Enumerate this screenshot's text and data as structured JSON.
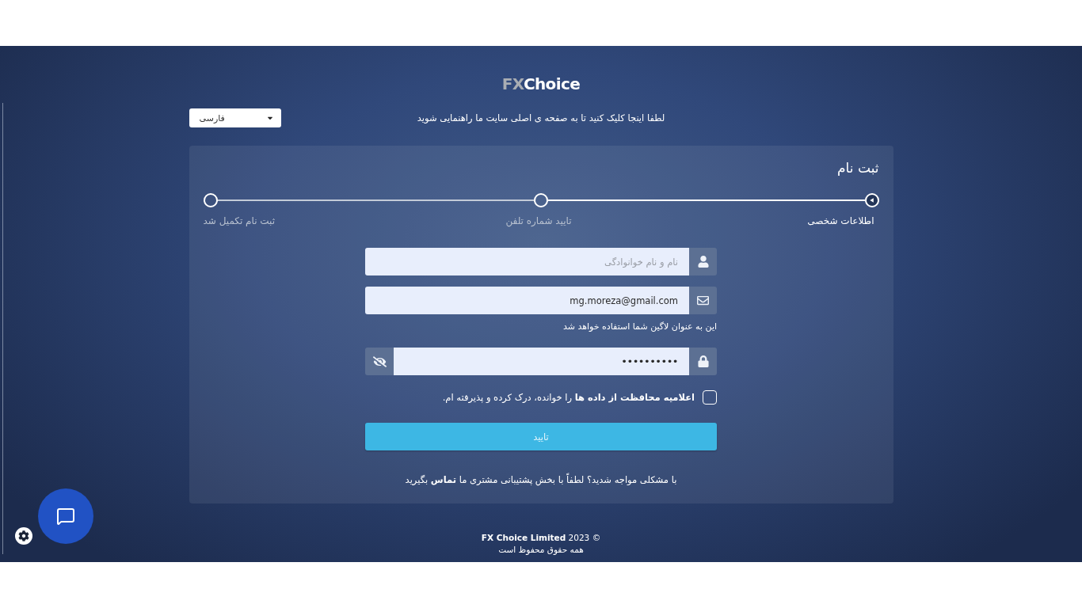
{
  "logo": {
    "prefix": "FX",
    "name": "Choice"
  },
  "header": {
    "language": "فارسی",
    "home_link": "لطفا اینجا کلیک کنید تا به صفحه ی اصلی سایت ما راهنمایی شوید"
  },
  "registration": {
    "title": "ثبت نام",
    "steps": [
      {
        "label": "اطلاعات شخصی",
        "selected": true
      },
      {
        "label": "تایید شماره تلفن",
        "selected": false
      },
      {
        "label": "ثبت نام تکمیل شد",
        "selected": false
      }
    ],
    "fields": [
      {
        "kind": "name",
        "placeholder": "نام و نام خوانوادگی"
      },
      {
        "kind": "email",
        "value": "mg.moreza@gmail.com",
        "hint": "این به عنوان لاگین شما استفاده خواهد شد"
      },
      {
        "kind": "password",
        "value": "••••••••••"
      }
    ],
    "consent": {
      "checked": false,
      "text": "**اعلامیه محافظت از داده ها** را خوانده، درک کرده و پذیرفته ام."
    },
    "submit_button": "تایید",
    "support_text": "با مشکلی مواجه شدید؟ لطفاً با بخش پشتیبانی مشتری ما **تماس** بگیرید"
  },
  "footer": {
    "copyright": "© 2023 **FX Choice Limited**",
    "rights": "همه حقوق محفوظ است"
  }
}
